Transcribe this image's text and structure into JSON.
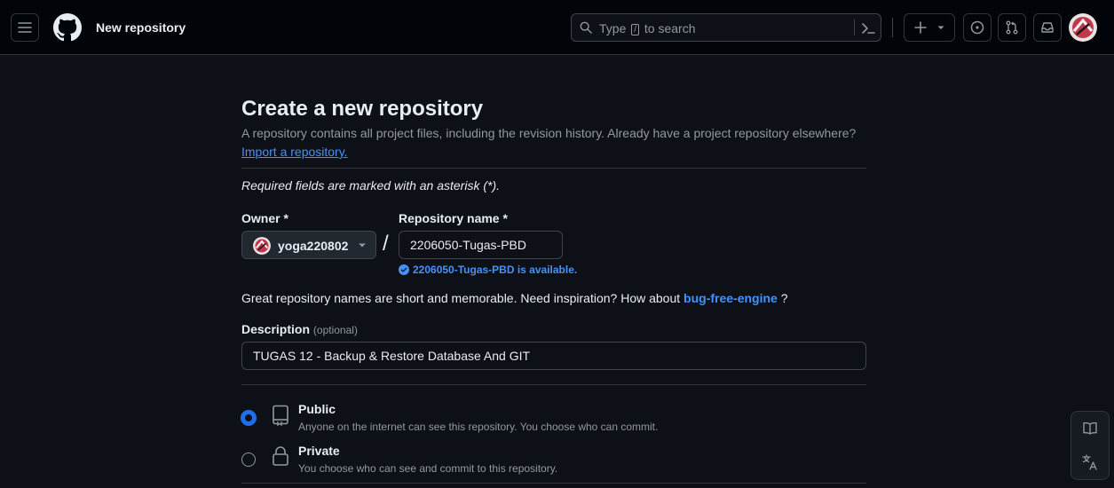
{
  "header": {
    "title": "New repository",
    "search": {
      "prefix": "Type",
      "key": "/",
      "suffix": "to search"
    }
  },
  "page": {
    "heading": "Create a new repository",
    "lead": "A repository contains all project files, including the revision history. Already have a project repository elsewhere?",
    "import_link": "Import a repository.",
    "required_note": "Required fields are marked with an asterisk (*)."
  },
  "form": {
    "owner_label": "Owner *",
    "owner_value": "yoga220802",
    "repo_name_label": "Repository name *",
    "repo_name_value": "2206050-Tugas-PBD",
    "availability": "2206050-Tugas-PBD is available.",
    "inspiration_text": "Great repository names are short and memorable. Need inspiration? How about",
    "suggestion": "bug-free-engine",
    "suggestion_suffix": "?",
    "description_label": "Description",
    "description_optional": "(optional)",
    "description_value": "TUGAS 12 - Backup & Restore Database And GIT",
    "visibility": {
      "selected": "public",
      "public_title": "Public",
      "public_desc": "Anyone on the internet can see this repository. You choose who can commit.",
      "private_title": "Private",
      "private_desc": "You choose who can see and commit to this repository."
    }
  },
  "colors": {
    "background": "#0d1117",
    "header_bg": "#010409",
    "accent": "#4493f8",
    "border": "#30363d"
  },
  "icons": [
    "menu-icon",
    "github-logo",
    "search-icon",
    "command-palette-icon",
    "plus-icon",
    "caret-down-icon",
    "issues-icon",
    "pull-requests-icon",
    "inbox-icon",
    "avatar",
    "check-circle-icon",
    "repo-icon",
    "lock-icon",
    "book-icon",
    "translate-icon"
  ]
}
